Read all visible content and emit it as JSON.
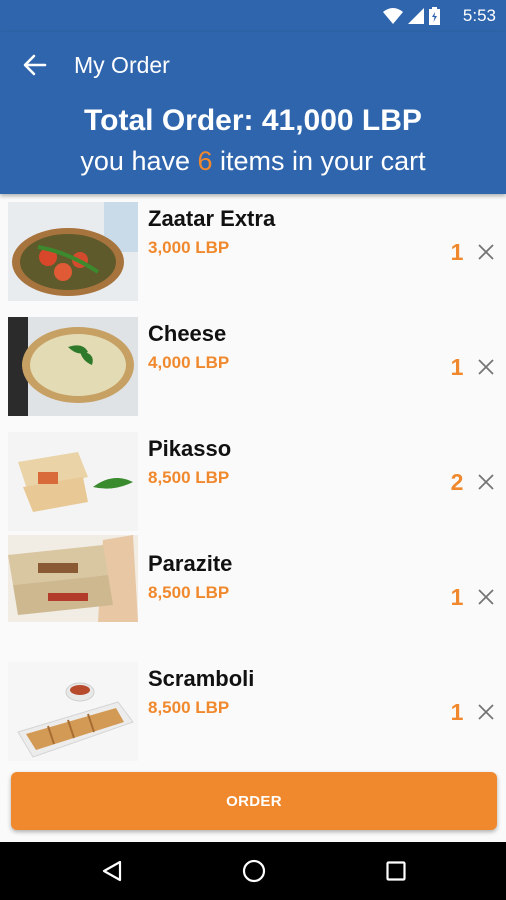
{
  "status_bar": {
    "time": "5:53",
    "icons": [
      "wifi-icon",
      "cell-signal-icon",
      "battery-icon"
    ]
  },
  "app_bar": {
    "back_icon": "arrow-left-icon",
    "title": "My Order"
  },
  "summary": {
    "total_label": "Total Order: 41,000 LBP",
    "count_prefix": "you have ",
    "count": "6",
    "count_suffix": " items in your cart"
  },
  "items": [
    {
      "name": "Zaatar Extra",
      "price": "3,000 LBP",
      "qty": "1",
      "image": "zaatar-manakish-photo"
    },
    {
      "name": "Cheese",
      "price": "4,000 LBP",
      "qty": "1",
      "image": "cheese-manakish-photo"
    },
    {
      "name": "Pikasso",
      "price": "8,500 LBP",
      "qty": "2",
      "image": "pikasso-wrap-photo"
    },
    {
      "name": "Parazite",
      "price": "8,500 LBP",
      "qty": "1",
      "image": "parazite-wrap-photo"
    },
    {
      "name": "Scramboli",
      "price": "8,500 LBP",
      "qty": "1",
      "image": "scramboli-photo"
    }
  ],
  "order_button": {
    "label": "ORDER"
  },
  "nav_bar": {
    "icons": [
      "nav-back-icon",
      "nav-home-icon",
      "nav-recent-icon"
    ]
  },
  "colors": {
    "primary": "#2f65ad",
    "accent": "#f0892d",
    "background": "#fafafa",
    "text": "#111111"
  }
}
